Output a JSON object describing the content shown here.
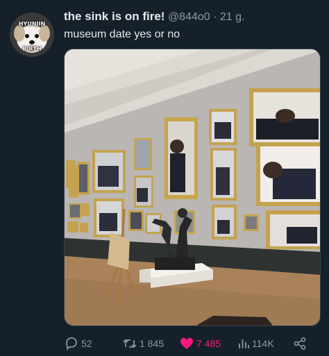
{
  "avatar": {
    "top_text": "HYUNJIN",
    "bottom_text": "BIRTH"
  },
  "tweet": {
    "display_name": "the sink is on fire!",
    "handle": "@844o0",
    "separator": "·",
    "time": "21 g.",
    "text": "museum date yes or no"
  },
  "actions": {
    "replies": "52",
    "retweets": "1 845",
    "likes": "7 485",
    "views": "114K"
  },
  "colors": {
    "background": "#15202b",
    "like": "#f91880",
    "muted": "#8b98a5"
  },
  "icons": [
    "reply-icon",
    "retweet-icon",
    "heart-icon",
    "views-icon",
    "share-icon"
  ]
}
